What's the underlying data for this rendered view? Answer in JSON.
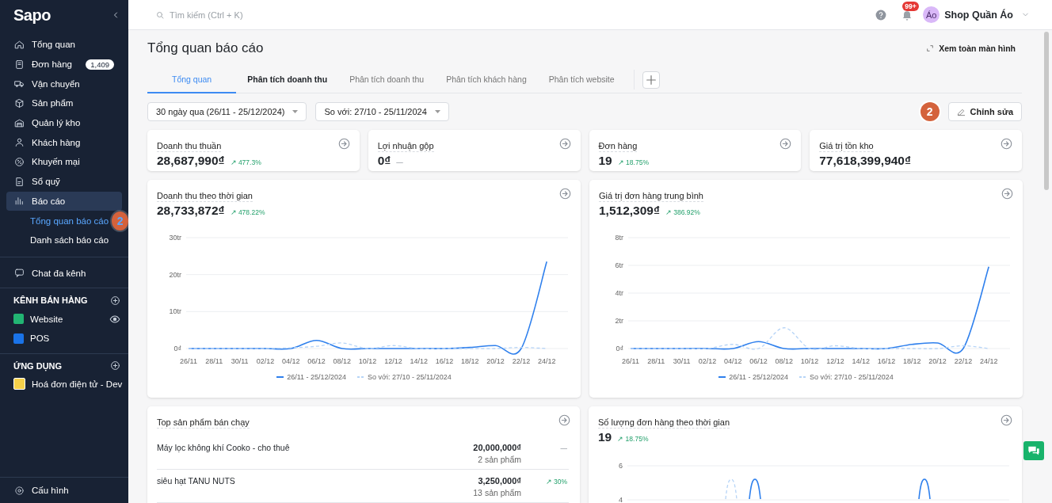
{
  "sidebar": {
    "logo": "Sapo",
    "nav": [
      {
        "label": "Tổng quan",
        "selected": false
      },
      {
        "label": "Đơn hàng",
        "badge": "1,409",
        "selected": false
      },
      {
        "label": "Vận chuyển",
        "selected": false
      },
      {
        "label": "Sản phẩm",
        "selected": false
      },
      {
        "label": "Quản lý kho",
        "selected": false
      },
      {
        "label": "Khách hàng",
        "selected": false
      },
      {
        "label": "Khuyến mại",
        "selected": false
      },
      {
        "label": "Sổ quỹ",
        "selected": false
      },
      {
        "label": "Báo cáo",
        "selected": true,
        "expanded": true,
        "children": [
          {
            "label": "Tổng quan báo cáo",
            "selected": true,
            "step_marker": "2"
          },
          {
            "label": "Danh sách báo cáo",
            "selected": false
          }
        ]
      }
    ],
    "chat": "Chat đa kênh",
    "sections": [
      {
        "title": "KÊNH BÁN HÀNG",
        "items": [
          {
            "label": "Website",
            "kind": "channel",
            "color": "#22b573",
            "preview": true
          },
          {
            "label": "POS",
            "kind": "channel",
            "color": "#1a73e8",
            "preview": false
          }
        ]
      },
      {
        "title": "ỨNG DỤNG",
        "items": [
          {
            "label": "Hoá đơn điện tử - Dev",
            "kind": "app",
            "preview": false
          }
        ]
      }
    ],
    "settings": "Cấu hình"
  },
  "topbar": {
    "search_placeholder": "Tìm kiếm (Ctrl + K)",
    "notification_badge": "99+",
    "avatar": "Áo",
    "shop_name": "Shop Quần Áo"
  },
  "page": {
    "title": "Tổng quan báo cáo",
    "fullscreen": "Xem toàn màn hình",
    "tabs": [
      {
        "label": "Tổng quan",
        "selected": true,
        "highlighted": false
      },
      {
        "label": "Phân tích doanh thu",
        "selected": false,
        "highlighted": true
      },
      {
        "label": "Phân tích doanh thu",
        "selected": false,
        "highlighted": false
      },
      {
        "label": "Phân tích khách hàng",
        "selected": false,
        "highlighted": false
      },
      {
        "label": "Phân tích website",
        "selected": false,
        "highlighted": false
      }
    ],
    "filters": [
      "30 ngày qua (26/11 - 25/12/2024)",
      "So với: 27/10 - 25/11/2024"
    ],
    "step_marker": "2",
    "edit": "Chỉnh sửa"
  },
  "stats": [
    {
      "label": "Doanh thu thuần",
      "value": "28,687,990₫",
      "change": "↗ 477.3%",
      "kind": "increase"
    },
    {
      "label": "Lợi nhuận gộp",
      "value": "0₫",
      "change": "—",
      "kind": "neutral"
    },
    {
      "label": "Đơn hàng",
      "value": "19",
      "change": "↗ 18.75%",
      "kind": "increase"
    },
    {
      "label": "Giá trị tồn kho",
      "value": "77,618,399,940₫"
    }
  ],
  "charts": [
    {
      "title": "Doanh thu theo thời gian",
      "value": "28,733,872₫",
      "change": "↗ 478.22%",
      "kind": "increase",
      "chart_data": {
        "type": "line",
        "grid": true,
        "categories": [
          "26/11",
          "28/11",
          "30/11",
          "02/12",
          "04/12",
          "06/12",
          "08/12",
          "10/12",
          "12/12",
          "14/12",
          "16/12",
          "18/12",
          "20/12",
          "22/12",
          "24/12"
        ],
        "ylim": [
          0,
          30
        ],
        "yticks": [
          {
            "value": 0,
            "label": "0₫"
          },
          {
            "value": 10,
            "label": "10tr"
          },
          {
            "value": 20,
            "label": "20tr"
          },
          {
            "value": 30,
            "label": "30tr"
          }
        ],
        "series": [
          {
            "name": "26/11 - 25/12/2024",
            "color": "#2f80ed",
            "line_style": "solid",
            "values": [
              0,
              0,
              0,
              0,
              0,
              2.2,
              0,
              0,
              0,
              0,
              0,
              0.3,
              0.8,
              0,
              23.5
            ]
          },
          {
            "name": "So với: 27/10 - 25/11/2024",
            "color": "#b6d4f7",
            "line_style": "dashed",
            "values": [
              0,
              0,
              0,
              0,
              0.2,
              0.6,
              1.5,
              0,
              0.8,
              0,
              0,
              0,
              0,
              0.3,
              0
            ]
          }
        ]
      }
    },
    {
      "title": "Giá trị đơn hàng trung bình",
      "value": "1,512,309₫",
      "change": "↗ 386.92%",
      "kind": "increase",
      "chart_data": {
        "type": "line",
        "grid": true,
        "categories": [
          "26/11",
          "28/11",
          "30/11",
          "02/12",
          "04/12",
          "06/12",
          "08/12",
          "10/12",
          "12/12",
          "14/12",
          "16/12",
          "18/12",
          "20/12",
          "22/12",
          "24/12"
        ],
        "ylim": [
          0,
          8
        ],
        "yticks": [
          {
            "value": 0,
            "label": "0₫"
          },
          {
            "value": 2,
            "label": "2tr"
          },
          {
            "value": 4,
            "label": "4tr"
          },
          {
            "value": 6,
            "label": "6tr"
          },
          {
            "value": 8,
            "label": "8tr"
          }
        ],
        "series": [
          {
            "name": "26/11 - 25/12/2024",
            "color": "#2f80ed",
            "line_style": "solid",
            "values": [
              0,
              0,
              0,
              0,
              0,
              0.5,
              0,
              0,
              0,
              0,
              0,
              0.3,
              0.4,
              0,
              5.9
            ]
          },
          {
            "name": "So với: 27/10 - 25/11/2024",
            "color": "#b6d4f7",
            "line_style": "dashed",
            "values": [
              0,
              0,
              0,
              0,
              0.3,
              0,
              1.5,
              0,
              0.2,
              0,
              0,
              0,
              0,
              0.2,
              0
            ]
          }
        ]
      }
    }
  ],
  "top_products": {
    "title": "Top sản phẩm bán chạy",
    "rows": [
      {
        "name": "Máy lọc không khí Cooko - cho thuê",
        "amount": "20,000,000₫",
        "quantity": "2 sản phẩm",
        "change": "—",
        "kind": "neutral"
      },
      {
        "name": "siêu hạt TANU NUTS",
        "amount": "3,250,000₫",
        "quantity": "13 sản phẩm",
        "change": "↗ 30%",
        "kind": "increase"
      }
    ]
  },
  "orders_chart": {
    "title": "Số lượng đơn hàng theo thời gian",
    "value": "19",
    "change": "↗ 18.75%",
    "kind": "increase",
    "axis_labels": [
      "6",
      "4"
    ]
  }
}
